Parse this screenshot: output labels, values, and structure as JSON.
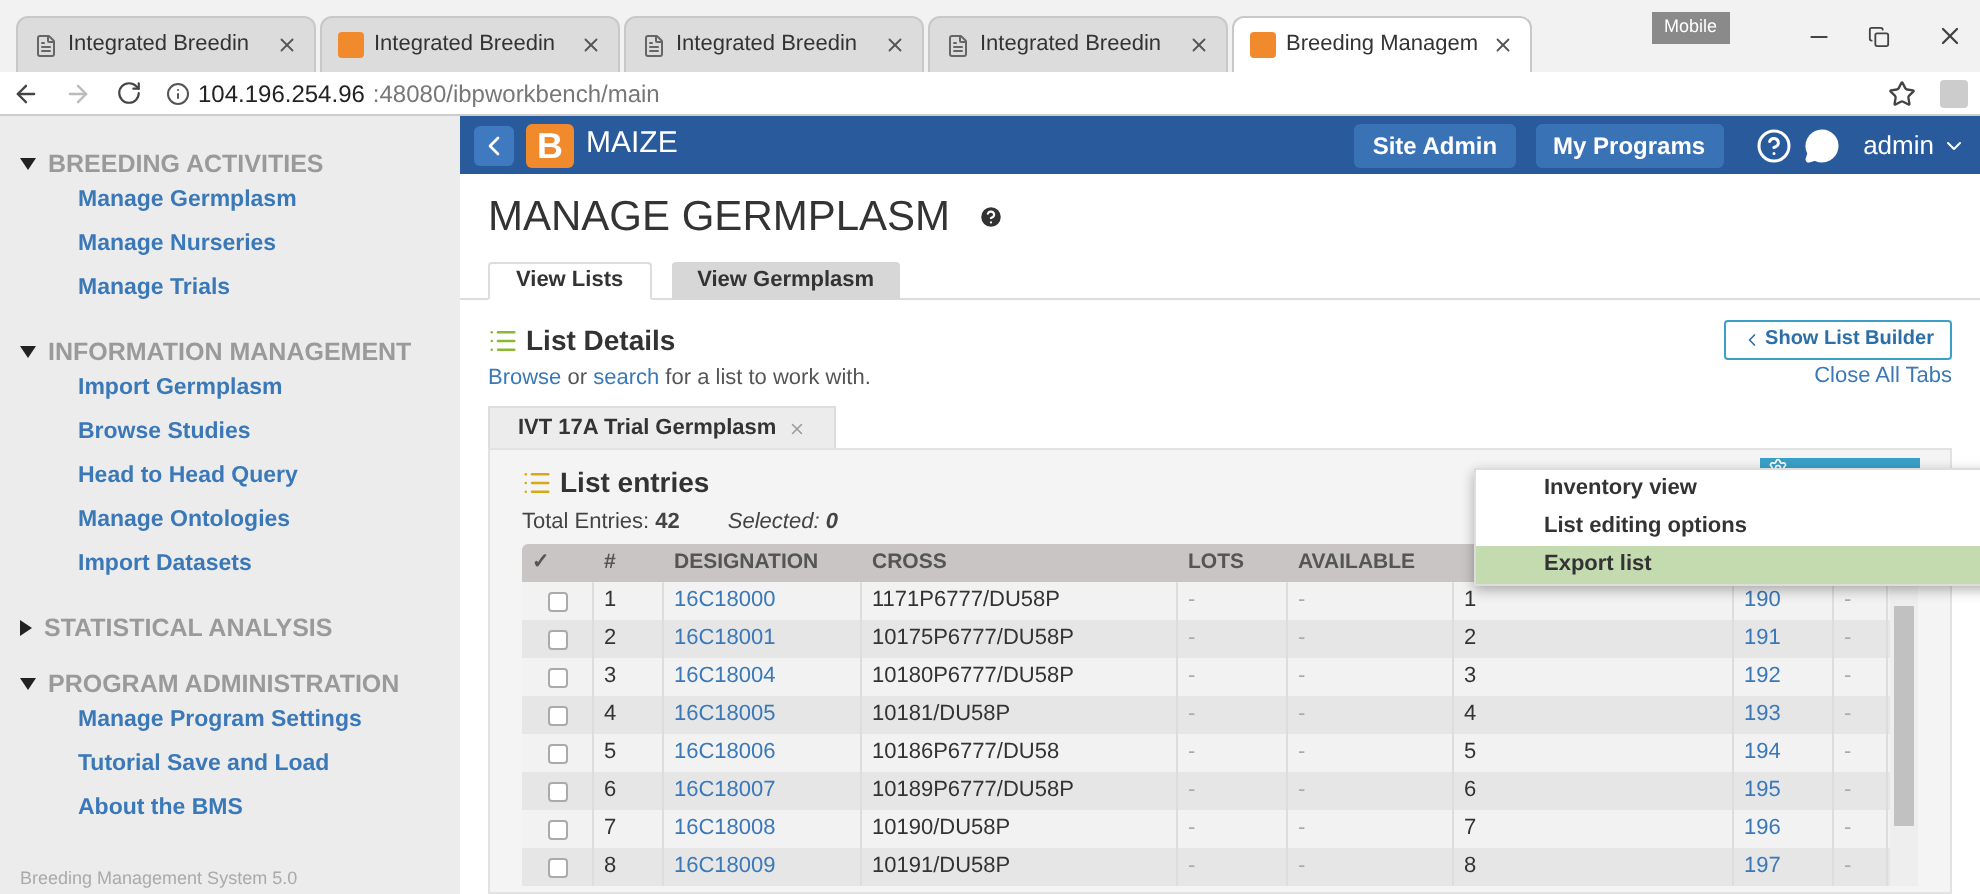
{
  "browser": {
    "tabs": [
      {
        "title": "Integrated Breedin",
        "kind": "page",
        "selected": false
      },
      {
        "title": "Integrated Breedin",
        "kind": "app",
        "selected": false
      },
      {
        "title": "Integrated Breedin",
        "kind": "page",
        "selected": false
      },
      {
        "title": "Integrated Breedin",
        "kind": "page",
        "selected": false
      },
      {
        "title": "Breeding Managem",
        "kind": "app",
        "selected": true
      }
    ],
    "profile": "Mobile",
    "url_host": "104.196.254.96",
    "url_rest": ":48080/ibpworkbench/main"
  },
  "sidebar": {
    "sections": [
      {
        "title": "BREEDING ACTIVITIES",
        "expanded": true,
        "items": [
          "Manage Germplasm",
          "Manage Nurseries",
          "Manage Trials"
        ]
      },
      {
        "title": "INFORMATION MANAGEMENT",
        "expanded": true,
        "items": [
          "Import Germplasm",
          "Browse Studies",
          "Head to Head Query",
          "Manage Ontologies",
          "Import Datasets"
        ]
      },
      {
        "title": "STATISTICAL ANALYSIS",
        "expanded": false
      },
      {
        "title": "PROGRAM ADMINISTRATION",
        "expanded": true,
        "items": [
          "Manage Program Settings",
          "Tutorial Save and Load",
          "About the BMS"
        ]
      }
    ],
    "footer": "Breeding Management System 5.0"
  },
  "header": {
    "logo": "B",
    "crop": "MAIZE",
    "buttons": [
      "Site Admin",
      "My Programs"
    ],
    "user": "admin"
  },
  "page": {
    "title": "MANAGE GERMPLASM",
    "tabs": [
      {
        "label": "View Lists",
        "selected": true
      },
      {
        "label": "View Germplasm",
        "selected": false
      }
    ],
    "list_details": {
      "title": "List Details",
      "browse": "Browse",
      "or": " or ",
      "search": "search",
      "rest": " for a list to work with.",
      "show_builder": "Show List Builder",
      "close_all": "Close All Tabs"
    },
    "open_list": "IVT 17A Trial Germplasm",
    "entries": {
      "title": "List entries",
      "total_label": "Total Entries:",
      "total": "42",
      "selected_label": "Selected:",
      "selected": "0"
    },
    "menu": [
      {
        "label": "Inventory view",
        "selected": false
      },
      {
        "label": "List editing options",
        "selected": false
      },
      {
        "label": "Export list",
        "selected": true
      }
    ],
    "table": {
      "check_column": "✓",
      "columns": [
        "#",
        "DESIGNATION",
        "CROSS",
        "LOTS",
        "AVAILABLE"
      ],
      "rows": [
        {
          "checked": false,
          "cells": [
            "1",
            "16C18000",
            "1171P6777/DU58P",
            "-",
            "-",
            "1",
            "190",
            "-"
          ]
        },
        {
          "checked": false,
          "cells": [
            "2",
            "16C18001",
            "10175P6777/DU58P",
            "-",
            "-",
            "2",
            "191",
            "-"
          ]
        },
        {
          "checked": false,
          "cells": [
            "3",
            "16C18004",
            "10180P6777/DU58P",
            "-",
            "-",
            "3",
            "192",
            "-"
          ]
        },
        {
          "checked": false,
          "cells": [
            "4",
            "16C18005",
            "10181/DU58P",
            "-",
            "-",
            "4",
            "193",
            "-"
          ]
        },
        {
          "checked": false,
          "cells": [
            "5",
            "16C18006",
            "10186P6777/DU58",
            "-",
            "-",
            "5",
            "194",
            "-"
          ]
        },
        {
          "checked": false,
          "cells": [
            "6",
            "16C18007",
            "10189P6777/DU58P",
            "-",
            "-",
            "6",
            "195",
            "-"
          ]
        },
        {
          "checked": false,
          "cells": [
            "7",
            "16C18008",
            "10190/DU58P",
            "-",
            "-",
            "7",
            "196",
            "-"
          ]
        },
        {
          "checked": false,
          "cells": [
            "8",
            "16C18009",
            "10191/DU58P",
            "-",
            "-",
            "8",
            "197",
            "-"
          ]
        }
      ]
    }
  }
}
